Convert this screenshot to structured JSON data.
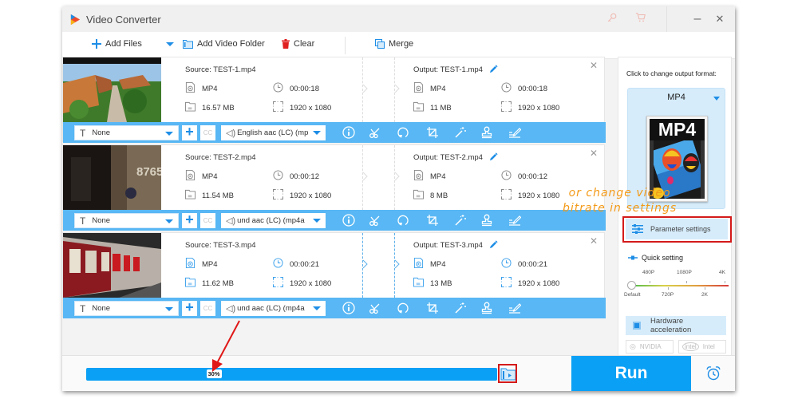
{
  "window": {
    "title": "Video Converter",
    "title_icons": [
      "key-icon",
      "cart-icon"
    ],
    "minimize_label": "–",
    "close_label": "✕"
  },
  "toolbar": {
    "add_files": "Add Files",
    "add_video_folder": "Add Video Folder",
    "clear": "Clear",
    "merge": "Merge"
  },
  "items": [
    {
      "source": "Source: TEST-1.mp4",
      "output": "Output: TEST-1.mp4",
      "src_format": "MP4",
      "src_duration": "00:00:18",
      "src_size": "16.57 MB",
      "src_resolution": "1920 x 1080",
      "out_format": "MP4",
      "out_duration": "00:00:18",
      "out_size": "11 MB",
      "out_resolution": "1920 x 1080",
      "subtitle": "None",
      "audio": "English aac (LC) (mp",
      "active": false
    },
    {
      "source": "Source: TEST-2.mp4",
      "output": "Output: TEST-2.mp4",
      "src_format": "MP4",
      "src_duration": "00:00:12",
      "src_size": "11.54 MB",
      "src_resolution": "1920 x 1080",
      "out_format": "MP4",
      "out_duration": "00:00:12",
      "out_size": "8 MB",
      "out_resolution": "1920 x 1080",
      "subtitle": "None",
      "audio": "und aac (LC) (mp4a",
      "active": false
    },
    {
      "source": "Source: TEST-3.mp4",
      "output": "Output: TEST-3.mp4",
      "src_format": "MP4",
      "src_duration": "00:00:21",
      "src_size": "11.62 MB",
      "src_resolution": "1920 x 1080",
      "out_format": "MP4",
      "out_duration": "00:00:21",
      "out_size": "13 MB",
      "out_resolution": "1920 x 1080",
      "subtitle": "None",
      "audio": "und aac (LC) (mp4a",
      "active": true
    }
  ],
  "item_bar": {
    "cc_label": "CC",
    "tools": [
      "info-icon",
      "scissors-icon",
      "rotate-icon",
      "crop-icon",
      "effects-wand-icon",
      "watermark-stamp-icon",
      "edit-subtitle-icon"
    ]
  },
  "panel": {
    "hint": "Click to change output format:",
    "format": "MP4",
    "format_image_label": "MP4",
    "parameter_settings": "Parameter settings",
    "quick_setting": "Quick setting",
    "quick_levels_top": [
      "480P",
      "1080P",
      "4K"
    ],
    "quick_levels_bottom": [
      "Default",
      "720P",
      "2K"
    ],
    "quick_selected": "Default",
    "hardware_acceleration": "Hardware acceleration",
    "hardware_enabled": true,
    "gpu_nvidia": "NVIDIA",
    "gpu_intel": "Intel"
  },
  "bottom": {
    "progress_percent": 30,
    "progress_label": "30%",
    "run": "Run"
  },
  "annotation": {
    "line1": "or change video",
    "line2": "bitrate in settings",
    "color": "#f39a18",
    "highlight_color": "#d41a1a"
  },
  "colors": {
    "accent": "#0aa0f5",
    "item_bar": "#58b7f4",
    "panel_button": "#d6ecfb"
  }
}
